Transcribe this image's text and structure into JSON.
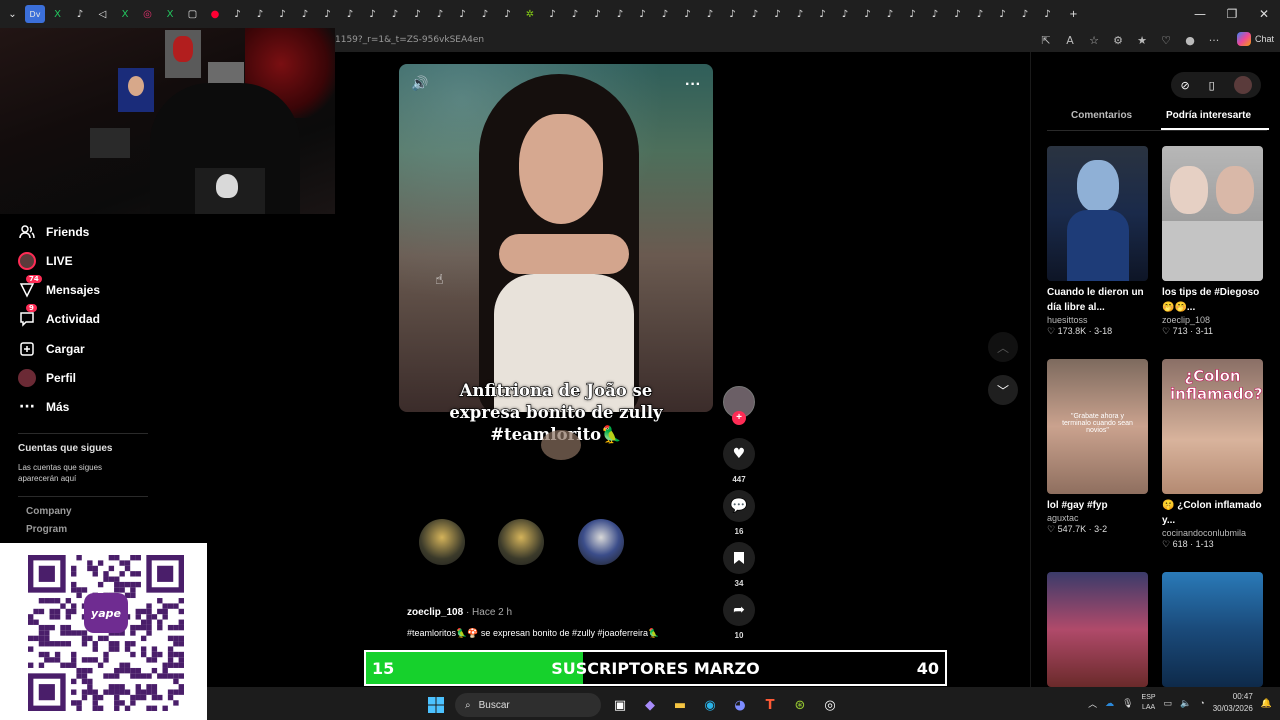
{
  "browser": {
    "url": "1159?_r=1&_t=ZS-956vkSEA4en",
    "tab_icons": [
      "Dv",
      "X",
      "♪",
      "◁",
      "X",
      "◎",
      "X",
      "▢",
      "●",
      "♪",
      "♪",
      "♪",
      "♪",
      "♪",
      "♪",
      "♪",
      "♪",
      "♪",
      "♪",
      "♪",
      "♪",
      "♪",
      "✲",
      "♪",
      "♪",
      "♪",
      "♪",
      "♪",
      "♪",
      "♪",
      "♪",
      "♪",
      "♪",
      "♪",
      "♪",
      "♪",
      "♪",
      "♪",
      "♪",
      "♪",
      "♪",
      "♪",
      "♪",
      "♪",
      "♪",
      "♪"
    ],
    "chat_label": "Chat"
  },
  "sidebar": {
    "items": [
      {
        "label": "Friends",
        "icon": "friends-icon",
        "glyph": "👥"
      },
      {
        "label": "LIVE",
        "icon": "live-avatar"
      },
      {
        "label": "Mensajes",
        "icon": "messages-icon",
        "glyph": "▽",
        "badge": "74"
      },
      {
        "label": "Actividad",
        "icon": "activity-icon",
        "glyph": "▭",
        "badge": "9"
      },
      {
        "label": "Cargar",
        "icon": "upload-icon",
        "glyph": "⊞"
      },
      {
        "label": "Perfil",
        "icon": "profile-avatar"
      },
      {
        "label": "Más",
        "icon": "more-icon",
        "glyph": "···"
      }
    ],
    "following_title": "Cuentas que sigues",
    "following_desc": "Las cuentas que sigues aparecerán aquí",
    "footer_links": [
      "Company",
      "Program"
    ]
  },
  "qr": {
    "logo_text": "yape"
  },
  "video": {
    "caption_overlay": "Anfitriona de João se expresa bonito de zully #teamlorito🦜",
    "author": "zoeclip_108",
    "time": "Hace 2 h",
    "description": "#teamloritos🦜🍄 se expresan bonito de #zully #joaoferreira🦜",
    "likes": "447",
    "comments": "16",
    "saves": "34",
    "shares": "10"
  },
  "subscriber_bar": {
    "label": "SUSCRIPTORES MARZO",
    "current": "15",
    "goal": "40",
    "progress": 0.375,
    "fill_color": "#16d12c"
  },
  "right_panel": {
    "tabs": [
      "Comentarios",
      "Podría interesarte"
    ],
    "active_tab": "Podría interesarte",
    "cards": [
      {
        "title": "Cuando le dieron un día libre al...",
        "user": "huesittoss",
        "likes": "173.8K",
        "date": "3-18"
      },
      {
        "title": "los tips de #Diegoso 🤭🤭...",
        "user": "zoeclip_108",
        "likes": "713",
        "date": "3-11"
      },
      {
        "title": "lol #gay #fyp",
        "user": "aguxtac",
        "likes": "547.7K",
        "date": "3-2"
      },
      {
        "title": "🤫 ¿Colon inflamado y...",
        "user": "cocinandoconlubmila",
        "likes": "618",
        "date": "1-13"
      },
      {
        "title": "",
        "user": "",
        "likes": "",
        "date": ""
      },
      {
        "title": "",
        "user": "",
        "likes": "",
        "date": ""
      }
    ],
    "thumb_texts": [
      "",
      "",
      "\"Grabate ahora y terminalo cuando sean novios\"",
      "¿Colon inflamado?",
      "",
      ""
    ]
  },
  "taskbar": {
    "search_placeholder": "Buscar",
    "lang": "ESP",
    "lang2": "LAA",
    "time": "00:47",
    "date": "30/03/2026"
  },
  "colors": {
    "accent": "#fe2c55",
    "progress": "#16d12c"
  }
}
